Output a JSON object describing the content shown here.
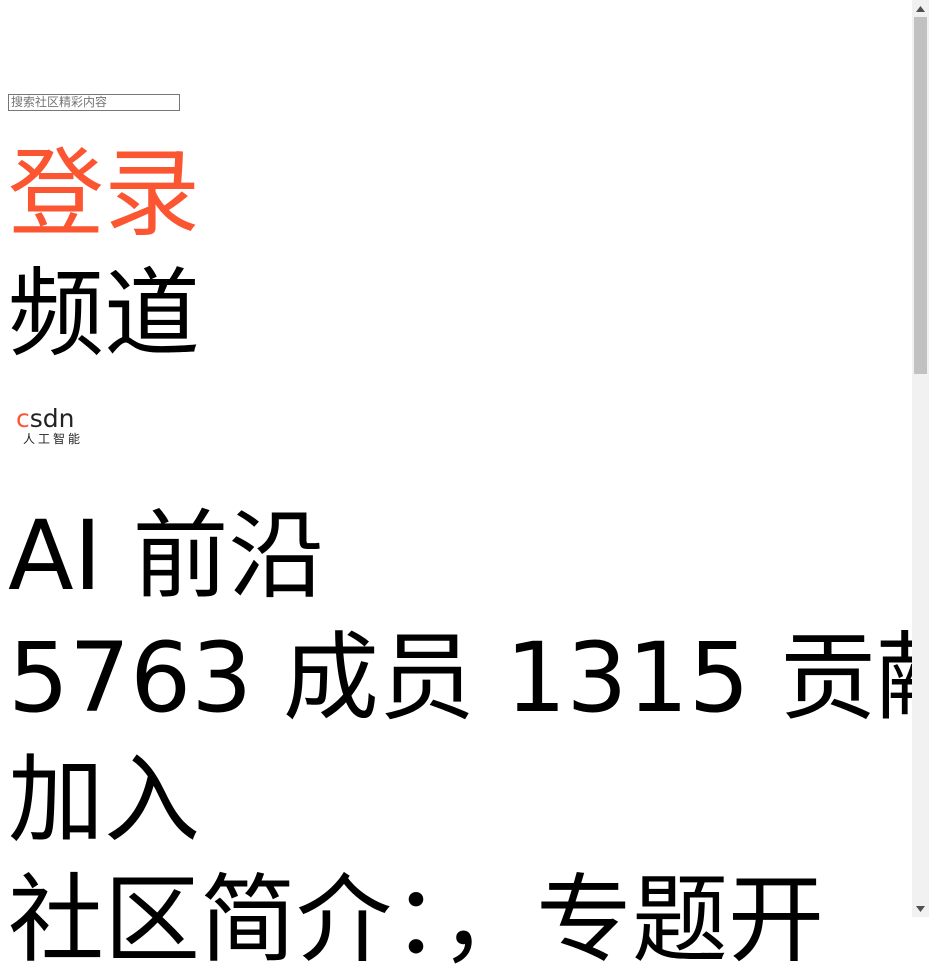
{
  "search": {
    "placeholder": "搜索社区精彩内容"
  },
  "header": {
    "login_label": "登录",
    "channel_label": "频道"
  },
  "logo": {
    "brand_c": "c",
    "brand_rest": "sdn",
    "subtitle": "人工智能"
  },
  "community": {
    "title": "AI 前沿",
    "members_count": "5763",
    "members_label": "成员",
    "contributions_count": "1315",
    "contributions_label": "贡献",
    "join_label": "加入",
    "intro_partial": "社区简介：，专题开"
  },
  "colors": {
    "accent": "#fc5531",
    "scrollbar_track": "#f1f1f1",
    "scrollbar_thumb": "#c1c1c1"
  },
  "icons": {
    "scroll_up": "triangle-up-icon",
    "scroll_down": "triangle-down-icon"
  }
}
